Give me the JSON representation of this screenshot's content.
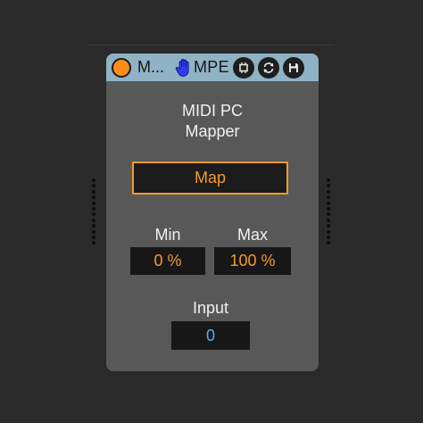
{
  "device": {
    "title": "M...",
    "mpe_label": "MPE",
    "name_line1": "MIDI PC",
    "name_line2": "Mapper",
    "power_color": "#ff8c1a",
    "header_color": "#8fb2c4",
    "icons": [
      "power-icon",
      "hand-icon",
      "hot-swap-icon",
      "refresh-icon",
      "save-icon"
    ]
  },
  "controls": {
    "map_label": "Map",
    "min_label": "Min",
    "min_value": "0 %",
    "max_label": "Max",
    "max_value": "100 %",
    "input_label": "Input",
    "input_value": "0"
  },
  "colors": {
    "accent": "#f59a2a",
    "value_blue": "#4fb3f0",
    "panel": "#585858",
    "background": "#2a2a2a"
  }
}
